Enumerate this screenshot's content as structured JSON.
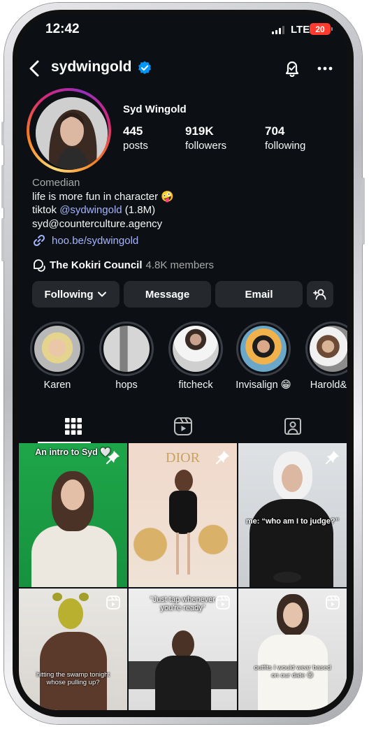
{
  "status_bar": {
    "time": "12:42",
    "network": "LTE",
    "battery": "20"
  },
  "header": {
    "username": "sydwingold",
    "verified": true
  },
  "profile": {
    "full_name": "Syd Wingold",
    "stats": [
      {
        "value": "445",
        "label": "posts"
      },
      {
        "value": "919K",
        "label": "followers"
      },
      {
        "value": "704",
        "label": "following"
      }
    ],
    "category": "Comedian",
    "bio_line1": "life is more fun in character 🤪",
    "bio_line2_prefix": "tiktok ",
    "bio_line2_mention": "@sydwingold",
    "bio_line2_suffix": " (1.8M)",
    "bio_line3": "syd@counterculture.agency",
    "link": "hoo.be/sydwingold",
    "channel_name": "The Kokiri Council",
    "channel_members": "4.8K members"
  },
  "actions": {
    "following": "Following",
    "message": "Message",
    "email": "Email"
  },
  "highlights": [
    {
      "label": "Karen"
    },
    {
      "label": "hops"
    },
    {
      "label": "fitcheck"
    },
    {
      "label": "Invisalign 😁"
    },
    {
      "label": "Harold&M"
    }
  ],
  "tabs": [
    "grid-icon",
    "reels-icon",
    "tagged-icon"
  ],
  "grid_posts": [
    {
      "caption": "An intro to Syd 🤍",
      "badge": "pin-icon"
    },
    {
      "caption": "DIOR",
      "badge": "pin-icon"
    },
    {
      "caption": "me: “who am I to judge?”",
      "badge": "pin-icon"
    },
    {
      "caption": "hitting the swamp tonight whose pulling up?",
      "badge": "reels-icon"
    },
    {
      "caption": "“Just tap whenever you're ready”",
      "badge": "reels-icon"
    },
    {
      "caption": "outfits I would wear based on our date 😉",
      "badge": "reels-icon"
    }
  ],
  "colors": {
    "background": "#0c1014",
    "button": "#25292e",
    "link": "#a5b4fc",
    "verified": "#0095f6"
  }
}
